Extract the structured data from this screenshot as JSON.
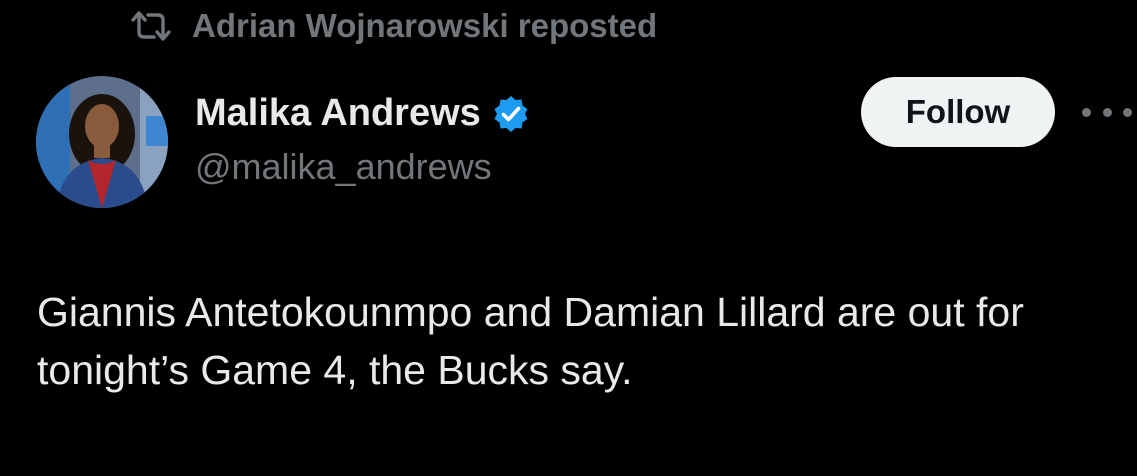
{
  "repost": {
    "icon": "repost-icon",
    "text": "Adrian Wojnarowski reposted"
  },
  "author": {
    "name": "Malika Andrews",
    "handle": "@malika_andrews",
    "verified_icon": "verified-badge-icon",
    "verified_color": "#1d9bf0"
  },
  "actions": {
    "follow_label": "Follow",
    "more_icon": "more-options-icon"
  },
  "tweet": {
    "text": "Giannis Antetokounmpo and Damian Lillard are out for tonight’s Game 4, the Bucks say."
  },
  "colors": {
    "background": "#000000",
    "primary_text": "#e7e9ea",
    "secondary_text": "#71767b",
    "follow_button_bg": "#eff3f4",
    "follow_button_text": "#0f1419"
  }
}
